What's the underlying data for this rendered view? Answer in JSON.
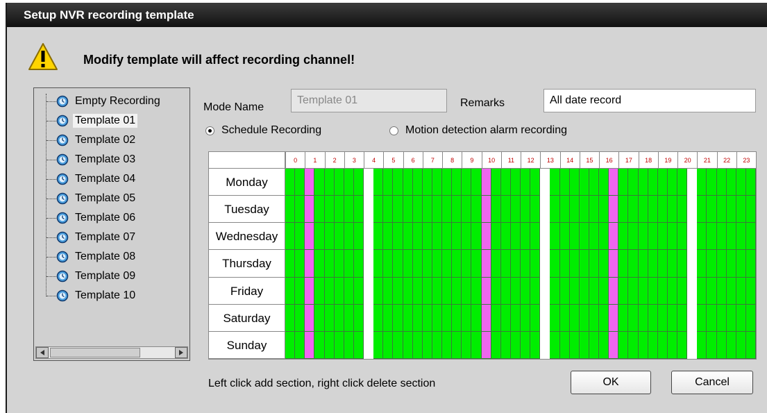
{
  "title": "Setup NVR recording template",
  "warning": "Modify template will affect recording channel!",
  "tree": {
    "items": [
      "Empty Recording",
      "Template 01",
      "Template 02",
      "Template 03",
      "Template 04",
      "Template 05",
      "Template 06",
      "Template 07",
      "Template 08",
      "Template 09",
      "Template 10"
    ],
    "selected": "Template 01"
  },
  "form": {
    "mode_name_label": "Mode Name",
    "mode_name_value": "Template 01",
    "remarks_label": "Remarks",
    "remarks_value": "All date record"
  },
  "radios": {
    "schedule": "Schedule Recording",
    "motion": "Motion detection alarm recording",
    "selected": "schedule"
  },
  "schedule": {
    "hours": [
      "0",
      "1",
      "2",
      "3",
      "4",
      "5",
      "6",
      "7",
      "8",
      "9",
      "10",
      "11",
      "12",
      "13",
      "14",
      "15",
      "16",
      "17",
      "18",
      "19",
      "20",
      "21",
      "22",
      "23"
    ],
    "days": [
      "Monday",
      "Tuesday",
      "Wednesday",
      "Thursday",
      "Friday",
      "Saturday",
      "Sunday"
    ],
    "half_hour_states": [
      "G",
      "G",
      "M",
      "G",
      "G",
      "G",
      "G",
      "G",
      "E",
      "G",
      "G",
      "G",
      "G",
      "G",
      "G",
      "G",
      "G",
      "G",
      "G",
      "G",
      "M",
      "G",
      "G",
      "G",
      "G",
      "G",
      "E",
      "G",
      "G",
      "G",
      "G",
      "G",
      "G",
      "M",
      "G",
      "G",
      "G",
      "G",
      "G",
      "G",
      "G",
      "E",
      "G",
      "G",
      "G",
      "G",
      "G",
      "G"
    ],
    "legend": {
      "G": "recording",
      "M": "motion",
      "E": "empty"
    },
    "colors": {
      "G": "#00ee00",
      "M": "#ee66ee",
      "E": "#ffffff"
    }
  },
  "hint": "Left click add section, right click delete section",
  "buttons": {
    "ok": "OK",
    "cancel": "Cancel"
  }
}
